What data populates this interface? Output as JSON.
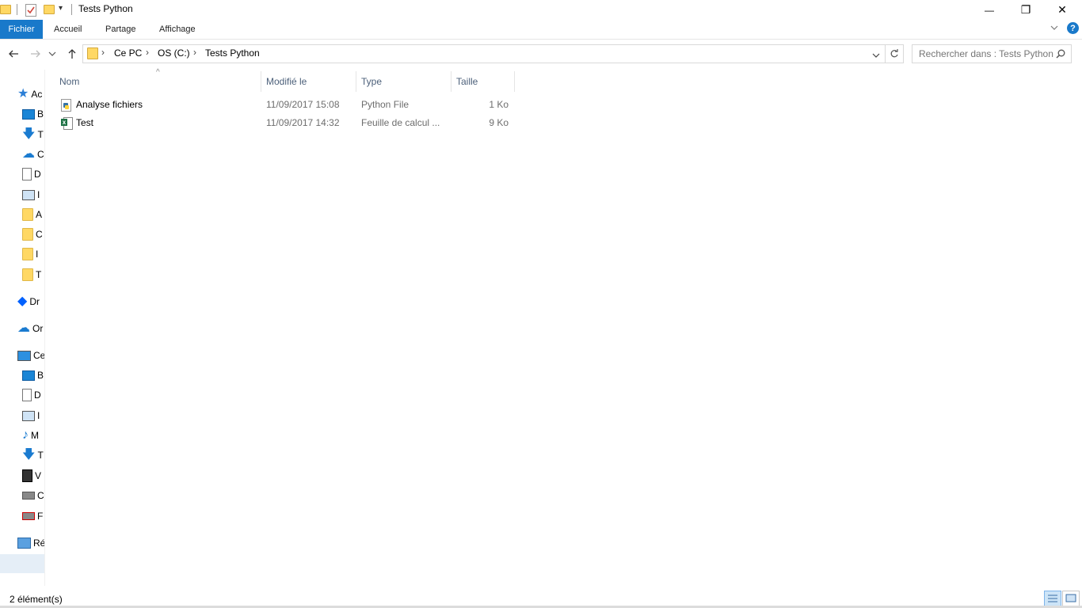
{
  "window": {
    "title": "Tests Python",
    "controls": {
      "minimize": "—",
      "maximize": "❐",
      "close": "✕"
    }
  },
  "ribbon": {
    "tabs": [
      {
        "label": "Fichier",
        "active": true
      },
      {
        "label": "Accueil"
      },
      {
        "label": "Partage"
      },
      {
        "label": "Affichage"
      }
    ],
    "expand_icon": "chevron-down-icon",
    "help_icon": "help-icon",
    "help_glyph": "?"
  },
  "address": {
    "breadcrumb": [
      "Ce PC",
      "OS (C:)",
      "Tests Python"
    ],
    "separator": "›",
    "search_placeholder": "Rechercher dans : Tests Python"
  },
  "nav_pane": {
    "items": [
      {
        "icon": "star-icon",
        "label": "Ac"
      },
      {
        "icon": "desktop-icon",
        "label": "B"
      },
      {
        "icon": "download-icon",
        "label": "T"
      },
      {
        "icon": "onedrive-check-icon",
        "label": "C"
      },
      {
        "icon": "document-icon",
        "label": "D"
      },
      {
        "icon": "pictures-icon",
        "label": "I"
      },
      {
        "icon": "folder-icon",
        "label": "A"
      },
      {
        "icon": "folder-icon",
        "label": "C"
      },
      {
        "icon": "folder-icon",
        "label": "I"
      },
      {
        "icon": "folder-icon",
        "label": "T"
      },
      {
        "icon": "dropbox-icon",
        "label": "Dr"
      },
      {
        "icon": "onedrive-icon",
        "label": "Or"
      },
      {
        "icon": "computer-icon",
        "label": "Ce"
      },
      {
        "icon": "desktop-icon",
        "label": "B"
      },
      {
        "icon": "document-icon",
        "label": "D"
      },
      {
        "icon": "pictures-icon",
        "label": "I"
      },
      {
        "icon": "music-icon",
        "label": "M"
      },
      {
        "icon": "download-icon",
        "label": "T"
      },
      {
        "icon": "video-icon",
        "label": "V"
      },
      {
        "icon": "windows-drive-icon",
        "label": "C"
      },
      {
        "icon": "disconnected-drive-icon",
        "label": "F"
      },
      {
        "icon": "network-icon",
        "label": "Ré"
      }
    ],
    "selected_index": 19
  },
  "file_list": {
    "columns": [
      "Nom",
      "Modifié le",
      "Type",
      "Taille"
    ],
    "sort_indicator": "^",
    "rows": [
      {
        "icon": "python-file-icon",
        "name": "Analyse fichiers",
        "modified": "11/09/2017 15:08",
        "type": "Python File",
        "size": "1 Ko"
      },
      {
        "icon": "excel-file-icon",
        "name": "Test",
        "modified": "11/09/2017 14:32",
        "type": "Feuille de calcul ...",
        "size": "9 Ko"
      }
    ]
  },
  "status_bar": {
    "item_count": "2 élément(s)"
  },
  "colors": {
    "accent": "#1979ca",
    "header_text": "#4c607a",
    "meta_text": "#6d6d6d",
    "folder": "#ffd864"
  }
}
